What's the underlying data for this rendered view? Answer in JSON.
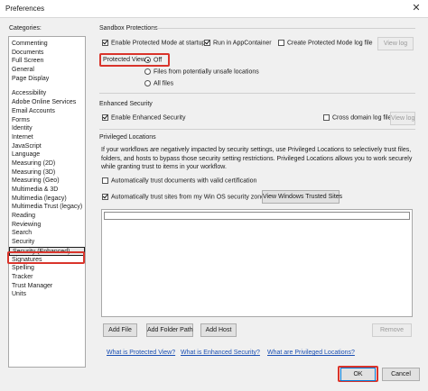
{
  "window": {
    "title": "Preferences",
    "close_glyph": "✕"
  },
  "categories": {
    "label": "Categories:",
    "group1": [
      "Commenting",
      "Documents",
      "Full Screen",
      "General",
      "Page Display"
    ],
    "group2": [
      "Accessibility",
      "Adobe Online Services",
      "Email Accounts",
      "Forms",
      "Identity",
      "Internet",
      "JavaScript",
      "Language",
      "Measuring (2D)",
      "Measuring (3D)",
      "Measuring (Geo)",
      "Multimedia & 3D",
      "Multimedia (legacy)",
      "Multimedia Trust (legacy)",
      "Reading",
      "Reviewing",
      "Search",
      "Security",
      "Security (Enhanced)",
      "Signatures",
      "Spelling",
      "Tracker",
      "Trust Manager",
      "Units"
    ],
    "selected": "Security (Enhanced)"
  },
  "sandbox": {
    "title": "Sandbox Protections",
    "enable_protected_mode": "Enable Protected Mode at startup",
    "enable_protected_mode_checked": true,
    "run_in_appcontainer": "Run in AppContainer",
    "run_in_appcontainer_checked": true,
    "create_log": "Create Protected Mode log file",
    "create_log_checked": false,
    "view_log": "View log",
    "protected_view_label": "Protected View",
    "pv_off": "Off",
    "pv_unsafe": "Files from potentially unsafe locations",
    "pv_all": "All files",
    "pv_selected": "Off"
  },
  "enhanced": {
    "title": "Enhanced Security",
    "enable_label": "Enable Enhanced Security",
    "enable_checked": true,
    "cross_domain": "Cross domain log file",
    "cross_domain_checked": false,
    "view_log": "View log"
  },
  "privileged": {
    "title": "Privileged Locations",
    "description": "If your workflows are negatively impacted by security settings, use Privileged Locations to selectively trust files, folders, and hosts to bypass those security setting restrictions. Privileged Locations allows you to work securely while granting trust to items in your workflow.",
    "auto_trust_cert": "Automatically trust documents with valid certification",
    "auto_trust_cert_checked": false,
    "auto_trust_win_os": "Automatically trust sites from my Win OS security zones",
    "auto_trust_win_os_checked": true,
    "view_trusted_sites": "View Windows Trusted Sites",
    "add_file": "Add File",
    "add_folder_path": "Add Folder Path",
    "add_host": "Add Host",
    "remove": "Remove"
  },
  "footer_links": {
    "protected_view": "What is Protected View?",
    "enhanced_security": "What is Enhanced Security?",
    "privileged_locations": "What are Privileged Locations?"
  },
  "buttons": {
    "ok": "OK",
    "cancel": "Cancel"
  },
  "colors": {
    "highlight": "#d9342b",
    "link": "#1a4fb3"
  }
}
